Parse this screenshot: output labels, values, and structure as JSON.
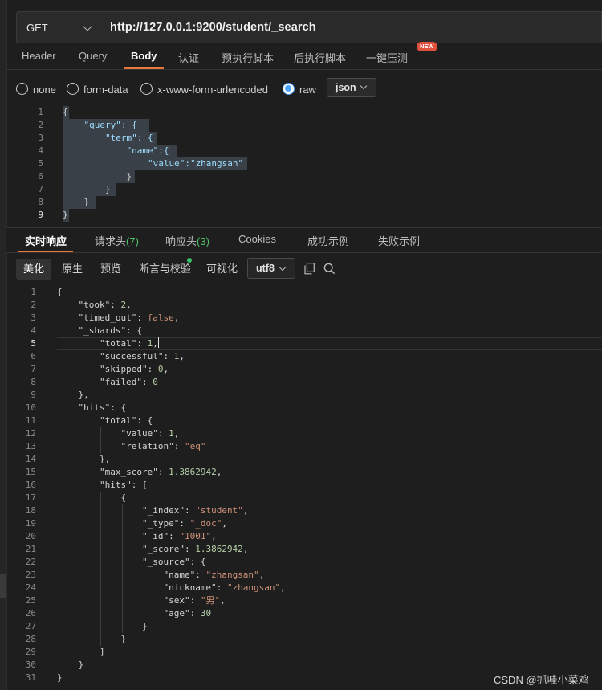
{
  "request": {
    "method": "GET",
    "url": "http://127.0.0.1:9200/student/_search"
  },
  "request_tabs": [
    "Header",
    "Query",
    "Body",
    "认证",
    "预执行脚本",
    "后执行脚本",
    "一键压测"
  ],
  "request_tab_active": "Body",
  "new_badge": "NEW",
  "body_types": [
    "none",
    "form-data",
    "x-www-form-urlencoded",
    "raw"
  ],
  "body_type_selected": "raw",
  "body_format": "json",
  "request_body_lines": [
    "{",
    "    \"query\": {",
    "        \"term\": {",
    "            \"name\":{",
    "                \"value\":\"zhangsan\"",
    "            }",
    "        }",
    "    }",
    "}"
  ],
  "response_tabs": {
    "realtime": "实时响应",
    "req_headers": "请求头",
    "req_headers_count": "(7)",
    "resp_headers": "响应头",
    "resp_headers_count": "(3)",
    "cookies": "Cookies",
    "success_example": "成功示例",
    "fail_example": "失败示例"
  },
  "view_modes": [
    "美化",
    "原生",
    "预览",
    "断言与校验",
    "可视化"
  ],
  "view_mode_active": "美化",
  "encoding": "utf8",
  "response_lines": [
    "{",
    "    \"took\": 2,",
    "    \"timed_out\": false,",
    "    \"_shards\": {",
    "        \"total\": 1,",
    "        \"successful\": 1,",
    "        \"skipped\": 0,",
    "        \"failed\": 0",
    "    },",
    "    \"hits\": {",
    "        \"total\": {",
    "            \"value\": 1,",
    "            \"relation\": \"eq\"",
    "        },",
    "        \"max_score\": 1.3862942,",
    "        \"hits\": [",
    "            {",
    "                \"_index\": \"student\",",
    "                \"_type\": \"_doc\",",
    "                \"_id\": \"1001\",",
    "                \"_score\": 1.3862942,",
    "                \"_source\": {",
    "                    \"name\": \"zhangsan\",",
    "                    \"nickname\": \"zhangsan\",",
    "                    \"sex\": \"男\",",
    "                    \"age\": 30",
    "                }",
    "            }",
    "        ]",
    "    }",
    "}"
  ],
  "response_active_line": 5,
  "watermark": "CSDN @抓哇小菜鸡",
  "colors": {
    "accent": "#e8793a",
    "key": "#9cdcfe",
    "string": "#ce9178",
    "number": "#b5cea8",
    "count": "#4ec06a",
    "radio_checked": "#4aa3ff"
  }
}
